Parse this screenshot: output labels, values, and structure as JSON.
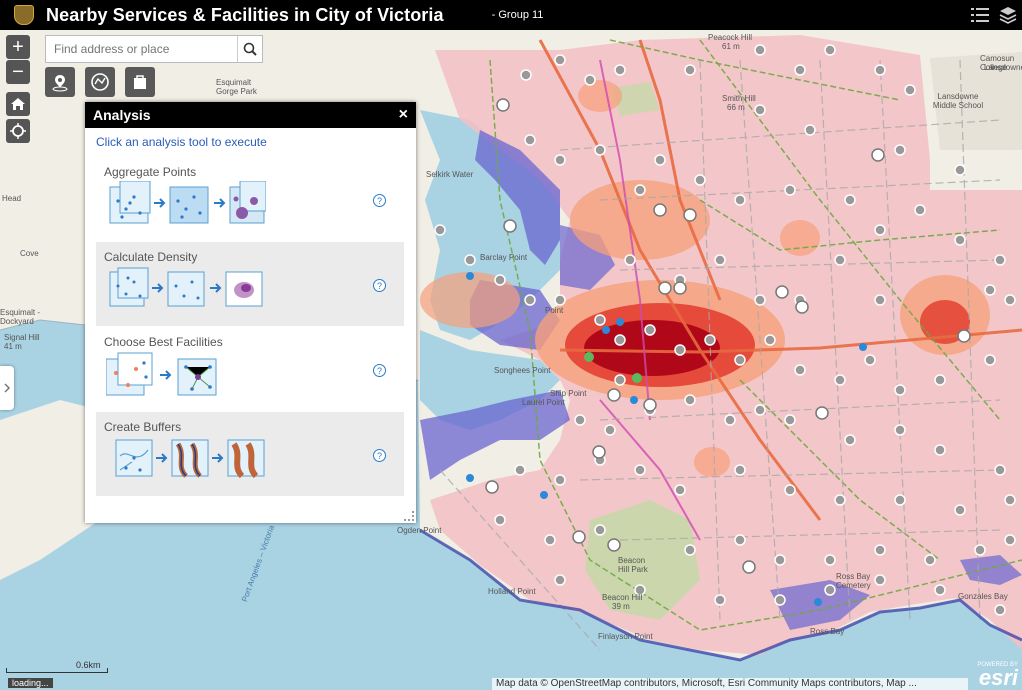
{
  "header": {
    "title": "Nearby Services & Facilities in City of Victoria",
    "subtitle": "- Group 11"
  },
  "search": {
    "placeholder": "Find address or place"
  },
  "zoom": {
    "in": "+",
    "out": "−"
  },
  "panel": {
    "title": "Analysis",
    "close": "×",
    "instruction": "Click an analysis tool to execute",
    "tools": [
      {
        "label": "Aggregate Points",
        "help": "?"
      },
      {
        "label": "Calculate Density",
        "help": "?"
      },
      {
        "label": "Choose Best Facilities",
        "help": "?"
      },
      {
        "label": "Create Buffers",
        "help": "?"
      }
    ]
  },
  "map_labels": {
    "peacock_hill": "Peacock Hill",
    "peacock_elev": "61 m",
    "smith_hill": "Smith Hill",
    "smith_elev": "66 m",
    "camosun": "Camosun College",
    "camosun_sub": "Lansdowne",
    "lansdowne": "Lansdowne Middle School",
    "esquimalt_gorge": "Esquimalt Gorge Park",
    "signal_hill": "Signal Hill",
    "signal_elev": "41 m",
    "esquimalt": "Esquimalt - Dockyard",
    "barclay_point": "Barclay Point",
    "songhees_point": "Songhees Point",
    "laurel_point": "Laurel Point",
    "ship_point": "Ship Point",
    "ogden_point": "Ogden Point",
    "holland_point": "Holland Point",
    "finlayson_point": "Finlayson Point",
    "beacon_hill": "Beacon Hill Park",
    "beacon_hill_summit": "Beacon Hill",
    "beacon_elev": "39 m",
    "ross_bay": "Ross Bay",
    "ross_cemetery": "Ross Bay Cemetery",
    "gonzales_bay": "Gonzales Bay",
    "selkirk": "Selkirk Water",
    "point_label": "Point",
    "head_label": "Head",
    "cove_label": "Cove",
    "port_angeles": "Port Angeles – Victoria"
  },
  "scale": {
    "label": "0.6km"
  },
  "status": {
    "loading": "loading..."
  },
  "attribution": {
    "text": "Map data © OpenStreetMap contributors, Microsoft, Esri Community Maps contributors, Map ..."
  },
  "esri": {
    "powered": "POWERED BY",
    "brand": "esri"
  },
  "colors": {
    "heat_core": "#b00818",
    "heat_mid": "#e23a2c",
    "heat_low": "#f6a07a",
    "zone": "#f3c0c4",
    "water_zone": "#6a66d0",
    "water": "#a9d2e3"
  }
}
